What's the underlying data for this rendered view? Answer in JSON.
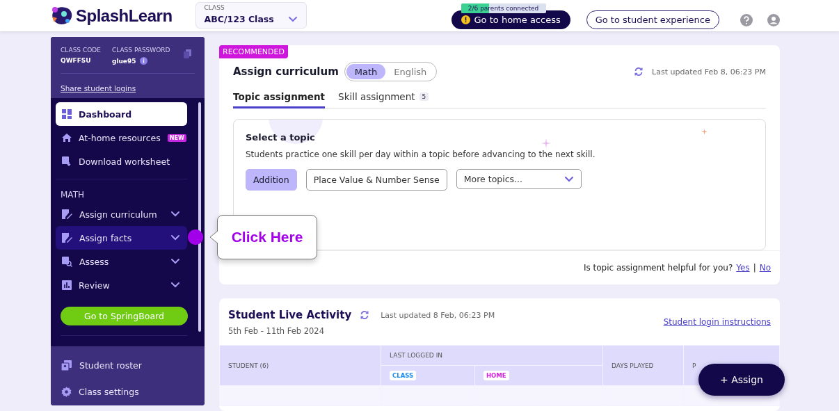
{
  "header": {
    "logo": "SplashLearn",
    "class_select": {
      "label": "CLASS",
      "value": "ABC/123 Class"
    },
    "parents_badge": {
      "text": "2/6 parents connected",
      "level": 0.33
    },
    "home_access_button": "Go to home access",
    "student_experience_button": "Go to student experience"
  },
  "sidebar": {
    "class_code_label": "CLASS CODE",
    "class_code": "QWFFSU",
    "class_password_label": "CLASS PASSWORD",
    "class_password": "glue95",
    "share_link": "Share student logins",
    "items": [
      {
        "label": "Dashboard",
        "selected": true,
        "highlighted": false,
        "expandable": false
      },
      {
        "label": "At-home resources",
        "badge": "NEW",
        "selected": false,
        "highlighted": false,
        "expandable": false
      },
      {
        "label": "Download worksheet",
        "selected": false,
        "highlighted": false,
        "expandable": false
      }
    ],
    "section": "MATH",
    "math_items": [
      {
        "label": "Assign curriculum",
        "selected": false,
        "highlighted": false,
        "expandable": true
      },
      {
        "label": "Assign facts",
        "selected": false,
        "highlighted": true,
        "expandable": true
      },
      {
        "label": "Assess",
        "selected": false,
        "highlighted": false,
        "expandable": true
      },
      {
        "label": "Review",
        "selected": false,
        "highlighted": false,
        "expandable": true
      }
    ],
    "springboard_button": "Go to SpringBoard",
    "bottom_items": [
      {
        "label": "Student roster"
      },
      {
        "label": "Class settings"
      }
    ]
  },
  "tooltip": "Click Here",
  "curriculum": {
    "badge": "RECOMMENDED",
    "title": "Assign curriculum",
    "subjects": [
      {
        "label": "Math",
        "selected": true
      },
      {
        "label": "English",
        "selected": false
      }
    ],
    "updated": "Last updated Feb 8, 06:23 PM",
    "tabs": [
      {
        "label": "Topic assignment",
        "selected": true
      },
      {
        "label": "Skill assignment",
        "count": "5",
        "selected": false
      }
    ],
    "topic_title": "Select a topic",
    "topic_description": "Students practice one skill per day within a topic before advancing to the next skill.",
    "topics": [
      {
        "label": "Addition",
        "selected": true
      },
      {
        "label": "Place Value & Number Sense",
        "selected": false
      }
    ],
    "more_topics": "More topics...",
    "feedback_question": "Is topic assignment helpful for you?",
    "feedback_yes": "Yes",
    "feedback_separator": "|",
    "feedback_no": "No"
  },
  "activity": {
    "title": "Student Live Activity",
    "updated": "Last updated 8 Feb, 06:23 PM",
    "date_range": "5th Feb - 11th Feb 2024",
    "login_link": "Student login instructions",
    "columns": [
      "STUDENT (6)",
      "LAST LOGGED IN",
      "DAYS PLAYED",
      "P"
    ],
    "subcolumns": [
      {
        "label": "CLASS",
        "color": "#1a8cf0"
      },
      {
        "label": "HOME",
        "color": "#d61ee0"
      }
    ]
  },
  "assign_button": "+ Assign"
}
